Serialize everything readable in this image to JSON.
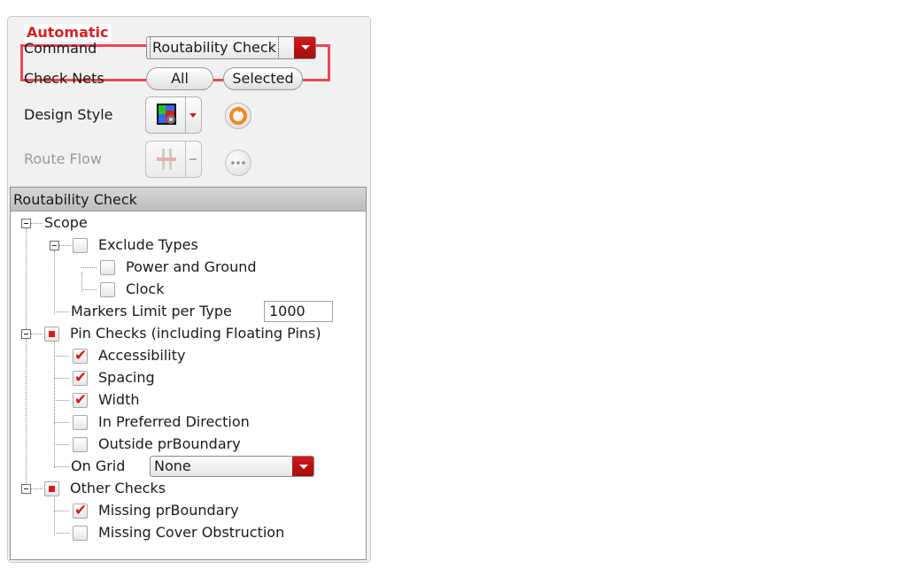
{
  "group": {
    "title": "Automatic"
  },
  "command": {
    "label": "Command",
    "value": "Routability Check"
  },
  "check_nets": {
    "label": "Check Nets",
    "all_label": "All",
    "selected_label": "Selected"
  },
  "design_style": {
    "label": "Design Style",
    "icon": "design-style-icon"
  },
  "route_flow": {
    "label": "Route Flow",
    "icon": "route-flow-icon"
  },
  "tree": {
    "header": "Routability Check",
    "scope": "Scope",
    "exclude_types": "Exclude Types",
    "power_ground": "Power and Ground",
    "clock": "Clock",
    "markers_label": "Markers Limit per Type",
    "markers_value": "1000",
    "pin_checks": "Pin Checks (including Floating Pins)",
    "accessibility": "Accessibility",
    "spacing": "Spacing",
    "width": "Width",
    "preferred_direction": "In Preferred Direction",
    "outside_prboundary": "Outside prBoundary",
    "on_grid_label": "On Grid",
    "on_grid_value": "None",
    "other_checks": "Other Checks",
    "missing_prboundary": "Missing prBoundary",
    "missing_cover": "Missing Cover Obstruction"
  },
  "colors": {
    "accent_red": "#d42323",
    "highlight": "#e84a55"
  }
}
